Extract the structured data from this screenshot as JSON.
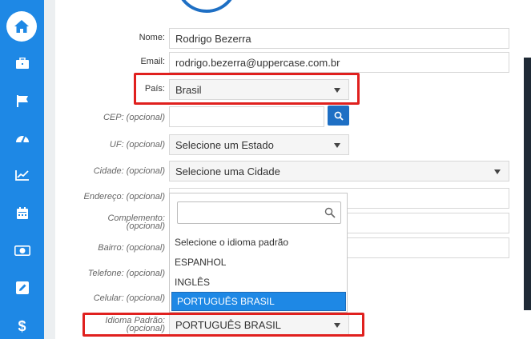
{
  "sidebar": {
    "items": [
      {
        "icon": "home-icon"
      },
      {
        "icon": "briefcase-icon"
      },
      {
        "icon": "flag-icon"
      },
      {
        "icon": "dashboard-icon"
      },
      {
        "icon": "chart-icon"
      },
      {
        "icon": "calendar-icon"
      },
      {
        "icon": "money-icon"
      },
      {
        "icon": "edit-icon"
      },
      {
        "icon": "dollar-icon",
        "glyph": "$"
      }
    ]
  },
  "form": {
    "nome": {
      "label": "Nome:",
      "value": "Rodrigo Bezerra"
    },
    "email": {
      "label": "Email:",
      "value": "rodrigo.bezerra@uppercase.com.br"
    },
    "pais": {
      "label": "País:",
      "value": "Brasil"
    },
    "cep": {
      "label": "CEP: (opcional)",
      "value": ""
    },
    "uf": {
      "label": "UF: (opcional)",
      "value": "Selecione um Estado"
    },
    "cidade": {
      "label": "Cidade: (opcional)",
      "value": "Selecione uma Cidade"
    },
    "endereco": {
      "label": "Endereço: (opcional)"
    },
    "complemento": {
      "label_line1": "Complemento:",
      "label_line2": "(opcional)"
    },
    "bairro": {
      "label": "Bairro: (opcional)"
    },
    "telefone": {
      "label": "Telefone: (opcional)"
    },
    "celular": {
      "label": "Celular: (opcional)"
    },
    "idioma": {
      "label_line1": "Idioma Padrão:",
      "label_line2": "(opcional)",
      "value": "PORTUGUÊS BRASIL"
    }
  },
  "dropdown": {
    "search_value": "",
    "options": [
      "Selecione o idioma padrão",
      "ESPANHOL",
      "INGLÊS",
      "PORTUGUÊS BRASIL"
    ],
    "highlighted_index": 3
  },
  "colors": {
    "sidebar": "#1e88e5",
    "accent": "#1e6fc4",
    "highlight_box": "#e0201e"
  }
}
